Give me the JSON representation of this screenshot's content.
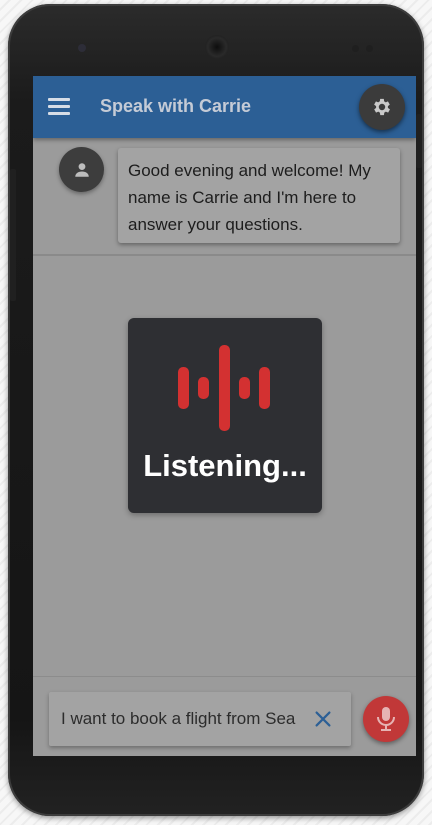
{
  "app": {
    "title": "Speak with Carrie",
    "accent_color": "#2c5f95"
  },
  "appbar": {
    "menu_icon": "hamburger-menu-icon",
    "settings_icon": "gear-icon"
  },
  "chat": {
    "messages": [
      {
        "sender_icon": "person-icon",
        "text": "Good evening and welcome! My name is Carrie and I'm here to answer your questions."
      }
    ]
  },
  "listening": {
    "icon": "sound-wave-icon",
    "label": "Listening...",
    "wave_color": "#d33131"
  },
  "input": {
    "value": "I want to book a flight from Sea",
    "clear_icon": "close-icon",
    "mic_icon": "microphone-icon",
    "mic_color": "#c13838"
  }
}
